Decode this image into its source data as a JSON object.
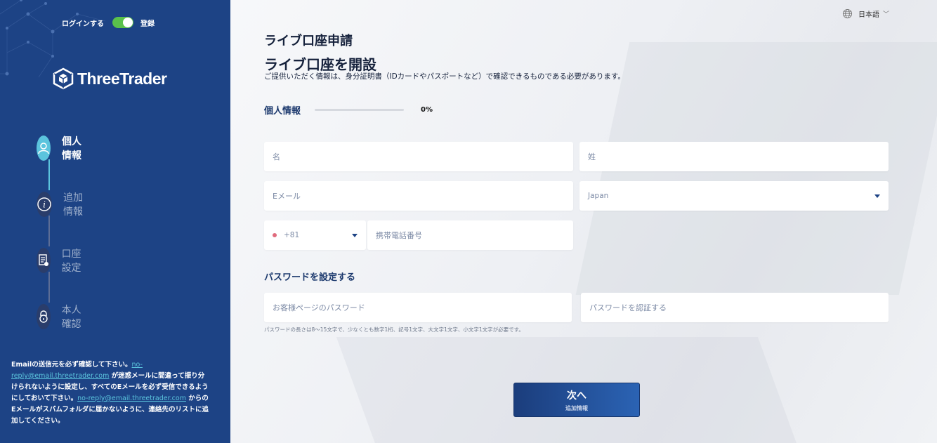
{
  "sidebar": {
    "toggle": {
      "left_label": "ログインする",
      "right_label": "登録"
    },
    "logo": "ThreeTrader",
    "steps": [
      {
        "label": "個人情報",
        "icon": "user-icon"
      },
      {
        "label": "追加情報",
        "icon": "info-icon"
      },
      {
        "label": "口座設定",
        "icon": "document-icon"
      },
      {
        "label": "本人確認",
        "icon": "lock-icon"
      }
    ],
    "notice": {
      "p1": "Emailの送信元を必ず確認して下さい。",
      "email1": "no-reply@email.threetrader.com",
      "p2": " が迷惑メールに間違って振り分けられないように設定し、すべてのEメールを必ず受信できるようにしておいて下さい。",
      "email2": "no-reply@email.threetrader.com",
      "p3": " からのEメールがスパムフォルダに届かないように、連絡先のリストに追加してください。"
    }
  },
  "header": {
    "language": "日本語"
  },
  "main": {
    "title": "ライブ口座申請",
    "heading": "ライブ口座を開設",
    "subtitle": "ご提供いただく情報は、身分証明書（IDカードやパスポートなど）で確認できるものである必要があります。",
    "section_title": "個人情報",
    "progress_percent": "0%",
    "progress_value": 0,
    "fields": {
      "first_name": "名",
      "last_name": "姓",
      "email": "Eメール",
      "country": "Japan",
      "phone_code": "+81",
      "mobile": "携帯電話番号"
    },
    "password_title": "パスワードを設定する",
    "password_fields": {
      "password": "お客様ページのパスワード",
      "confirm": "パスワードを認証する"
    },
    "password_hint": "パスワードの長さは8～15文字で、少なくとも数字1桁、記号1文字、大文字1文字、小文字1文字が必要です。",
    "next_button": {
      "label": "次へ",
      "sub": "追加情報"
    }
  },
  "colors": {
    "sidebar": "#1d4385",
    "accent": "#5bc4dd",
    "toggle": "#5ac14b"
  }
}
